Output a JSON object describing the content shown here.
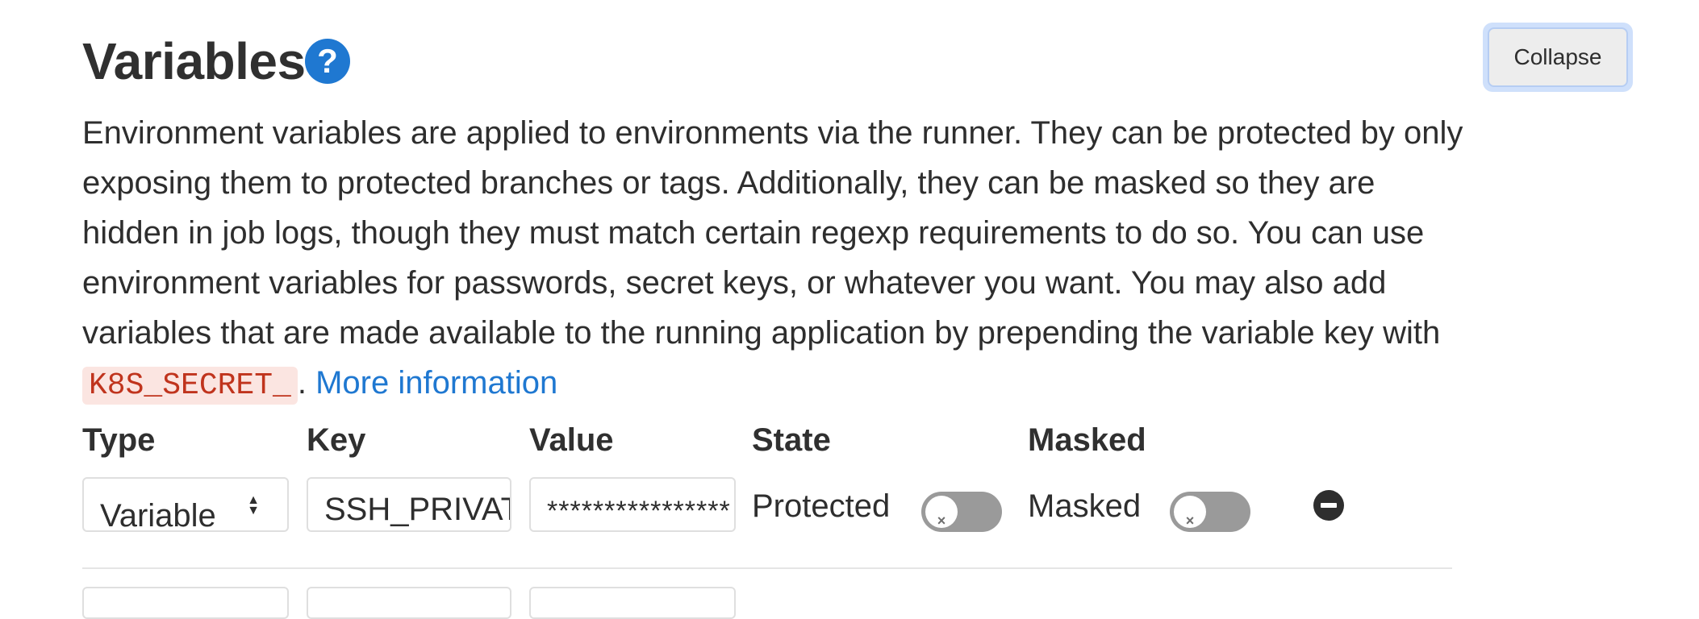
{
  "header": {
    "title": "Variables",
    "help_icon": "question-circle-icon",
    "collapse_label": "Collapse"
  },
  "description": {
    "text": "Environment variables are applied to environments via the runner. They can be protected by only exposing them to protected branches or tags. Additionally, they can be masked so they are hidden in job logs, though they must match certain regexp requirements to do so. You can use environment variables for passwords, secret keys, or whatever you want. You may also add variables that are made available to the running application by prepending the variable key with ",
    "code": "K8S_SECRET_",
    "after_code": ". ",
    "link": "More information"
  },
  "columns": {
    "type": "Type",
    "key": "Key",
    "value": "Value",
    "state": "State",
    "masked": "Masked"
  },
  "rows": [
    {
      "type": "Variable",
      "key": "SSH_PRIVATE_KEY",
      "value": "****************",
      "state_label": "Protected",
      "protected": false,
      "masked_label": "Masked",
      "masked": false
    }
  ],
  "colors": {
    "accent": "#1f78d1",
    "code_text": "#c0341d",
    "code_bg": "#fbe5e1",
    "toggle_off": "#9a9a9a"
  }
}
